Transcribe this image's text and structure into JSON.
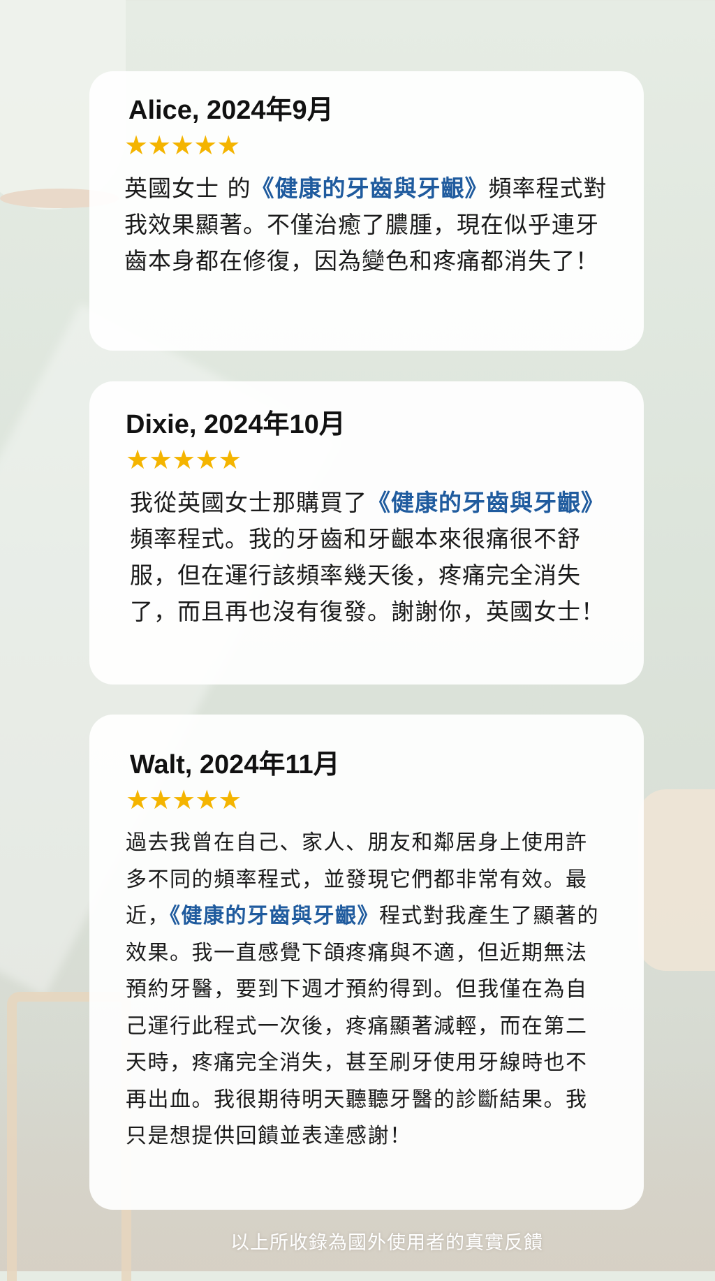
{
  "reviews": [
    {
      "author": "Alice, 2024年9月",
      "rating_stars": "★★★★★",
      "rating_value": 5,
      "text_before": "英國女士 的",
      "product": "《健康的牙齒與牙齦》",
      "text_after": "頻率程式對我效果顯著。不僅治癒了膿腫，現在似乎連牙齒本身都在修復，因為變色和疼痛都消失了！"
    },
    {
      "author": "Dixie, 2024年10月",
      "rating_stars": "★★★★★",
      "rating_value": 5,
      "text_before": "我從英國女士那購買了",
      "product": "《健康的牙齒與牙齦》",
      "text_after": "頻率程式。我的牙齒和牙齦本來很痛很不舒服，但在運行該頻率幾天後，疼痛完全消失了，而且再也沒有復發。謝謝你，英國女士！"
    },
    {
      "author": "Walt, 2024年11月",
      "rating_stars": "★★★★★",
      "rating_value": 5,
      "text_before": "過去我曾在自己、家人、朋友和鄰居身上使用許多不同的頻率程式，並發現它們都非常有效。最近，",
      "product": "《健康的牙齒與牙齦》",
      "text_after": "程式對我產生了顯著的效果。我一直感覺下頜疼痛與不適，但近期無法預約牙醫，要到下週才預約得到。但我僅在為自己運行此程式一次後，疼痛顯著減輕，而在第二天時，疼痛完全消失，甚至刷牙使用牙線時也不再出血。我很期待明天聽聽牙醫的診斷結果。我只是想提供回饋並表達感謝！"
    }
  ],
  "footer": {
    "note": "以上所收錄為國外使用者的真實反饋"
  },
  "colors": {
    "star": "#f4b400",
    "product_link": "#1f5b9e",
    "card_background": "#ffffff"
  }
}
